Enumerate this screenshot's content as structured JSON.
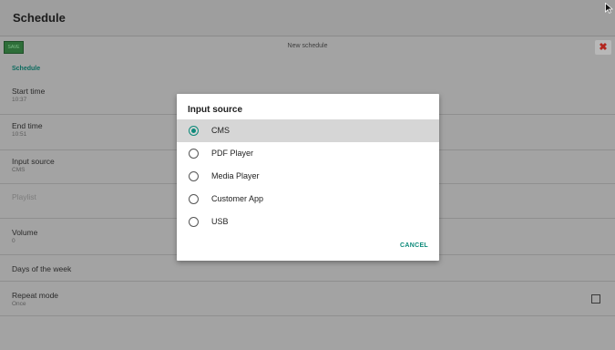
{
  "appbar": {
    "title": "Schedule"
  },
  "toolbar": {
    "save_label": "SAVE",
    "title": "New schedule",
    "close_glyph": "✖"
  },
  "section": {
    "label": "Schedule"
  },
  "rows": [
    {
      "label": "Start time",
      "value": "10:37"
    },
    {
      "label": "End time",
      "value": "10:51"
    },
    {
      "label": "Input source",
      "value": "CMS"
    },
    {
      "label": "Playlist",
      "value": ""
    },
    {
      "label": "Volume",
      "value": "0"
    },
    {
      "label": "Days of the week",
      "value": ""
    },
    {
      "label": "Repeat mode",
      "value": "Once"
    }
  ],
  "dialog": {
    "title": "Input source",
    "options": [
      {
        "label": "CMS",
        "selected": true
      },
      {
        "label": "PDF Player",
        "selected": false
      },
      {
        "label": "Media Player",
        "selected": false
      },
      {
        "label": "Customer App",
        "selected": false
      },
      {
        "label": "USB",
        "selected": false
      }
    ],
    "cancel_label": "CANCEL"
  },
  "colors": {
    "accent": "#0d8a7a",
    "close": "#b3261e",
    "save": "#2e6e39"
  },
  "icons": {
    "cursor": "mouse-pointer-icon",
    "close": "close-icon",
    "radio": "radio-button-icon",
    "checkbox": "checkbox-icon"
  }
}
